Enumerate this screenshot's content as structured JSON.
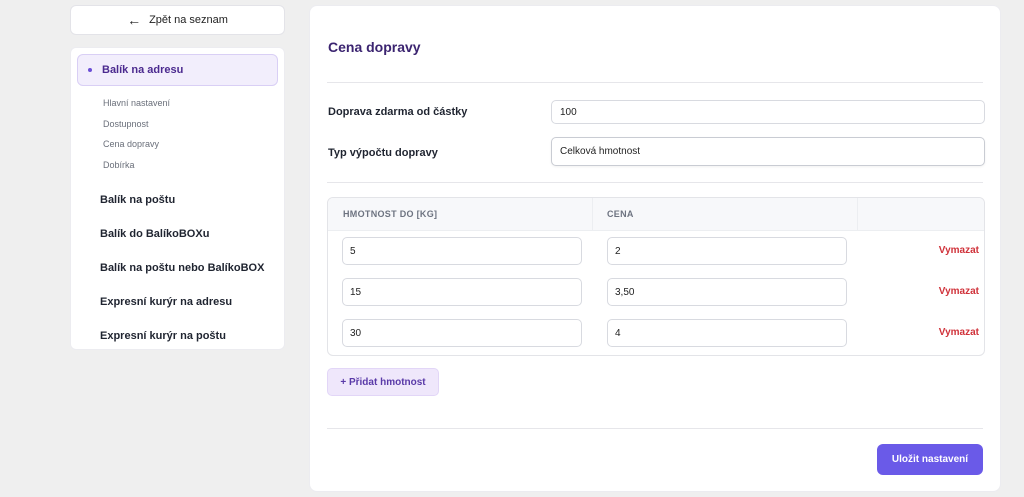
{
  "back_button": {
    "label": "Zpět na seznam",
    "icon": "arrow-left-icon"
  },
  "sidebar": {
    "active_item": "Balík na adresu",
    "sub_items": [
      "Hlavní nastavení",
      "Dostupnost",
      "Cena dopravy",
      "Dobírka"
    ],
    "items": [
      "Balík na poštu",
      "Balík do BalíkoBOXu",
      "Balík na poštu nebo BalíkoBOX",
      "Expresní kurýr na adresu",
      "Expresní kurýr na poštu"
    ]
  },
  "main": {
    "title": "Cena dopravy",
    "free_shipping": {
      "label": "Doprava zdarma od částky",
      "value": "100"
    },
    "calc_type": {
      "label": "Typ výpočtu dopravy",
      "value": "Celková hmotnost"
    },
    "table": {
      "headers": [
        "HMOTNOST DO [KG]",
        "CENA"
      ],
      "rows": [
        {
          "weight": "5",
          "price": "2",
          "delete_label": "Vymazat"
        },
        {
          "weight": "15",
          "price": "3,50",
          "delete_label": "Vymazat"
        },
        {
          "weight": "30",
          "price": "4",
          "delete_label": "Vymazat"
        }
      ]
    },
    "add_button": "+ Přidat hmotnost",
    "save_button": "Uložit nastavení"
  },
  "colors": {
    "accent": "#6a5ae8",
    "active_bg": "#f2eefc",
    "title": "#3b2470",
    "danger": "#d0323a"
  }
}
